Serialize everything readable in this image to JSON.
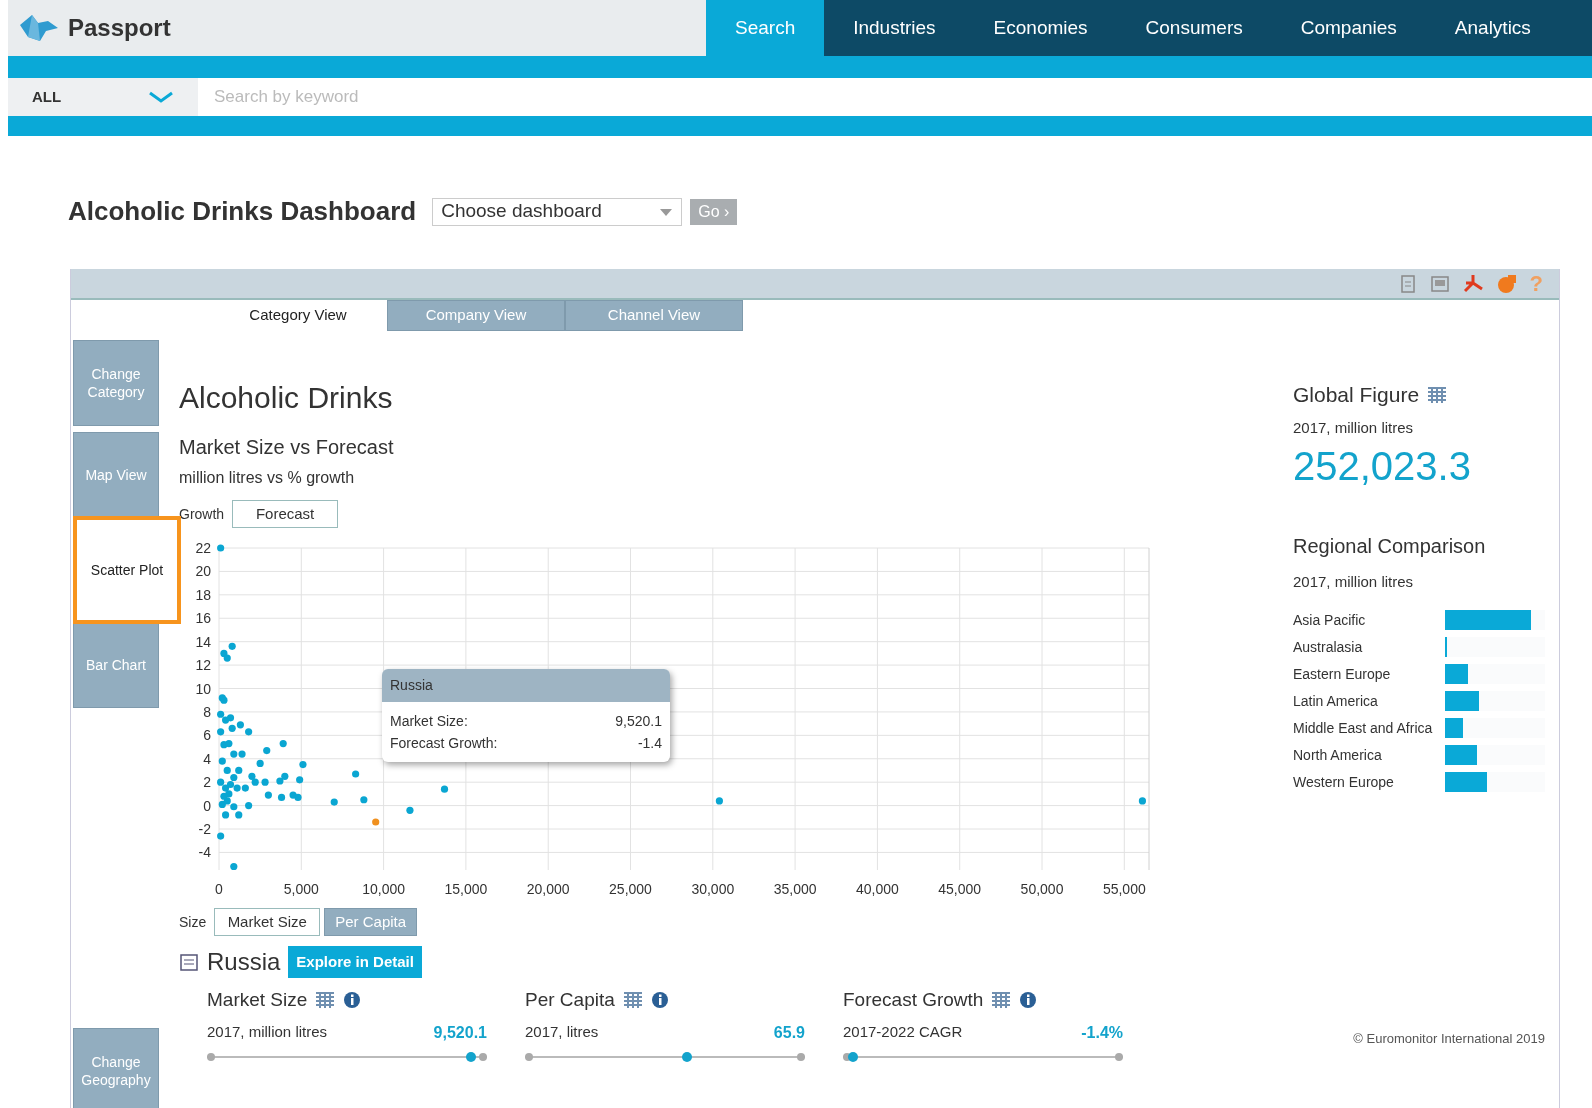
{
  "header": {
    "logo": "Passport",
    "nav": [
      {
        "label": "Search",
        "selected": true
      },
      {
        "label": "Industries",
        "selected": false
      },
      {
        "label": "Economies",
        "selected": false
      },
      {
        "label": "Consumers",
        "selected": false
      },
      {
        "label": "Companies",
        "selected": false
      },
      {
        "label": "Analytics",
        "selected": false
      }
    ]
  },
  "search": {
    "scope": "ALL",
    "placeholder": "Search by keyword"
  },
  "page": {
    "title": "Alcoholic Drinks Dashboard",
    "dashboard_select": "Choose dashboard",
    "go_button": "Go ›"
  },
  "toolbar": {
    "help": "?"
  },
  "tabs": [
    {
      "label": "Category View",
      "selected": true
    },
    {
      "label": "Company View",
      "selected": false
    },
    {
      "label": "Channel View",
      "selected": false
    }
  ],
  "side_buttons": [
    {
      "label": "Change Category",
      "selected": false
    },
    {
      "label": "Map View",
      "selected": false
    },
    {
      "label": "Scatter Plot",
      "selected": true
    },
    {
      "label": "Bar Chart",
      "selected": false
    }
  ],
  "geography_button": "Change Geography",
  "category_title": "Alcoholic Drinks",
  "chart_title": "Market Size vs Forecast",
  "chart_subtitle": "million litres vs % growth",
  "growth": {
    "label": "Growth",
    "options": [
      {
        "label": "Forecast",
        "selected": true
      }
    ]
  },
  "chart_data": {
    "type": "scatter",
    "x": [
      100,
      300,
      500,
      800,
      200,
      300,
      100,
      400,
      700,
      800,
      1300,
      1800,
      100,
      300,
      600,
      900,
      1400,
      2500,
      2900,
      3900,
      200,
      500,
      900,
      1200,
      2000,
      2200,
      2800,
      3700,
      4000,
      4900,
      5100,
      100,
      400,
      700,
      1100,
      1600,
      3000,
      3800,
      4500,
      4800,
      7000,
      8300,
      8800,
      11600,
      13700,
      30400,
      56100,
      200,
      500,
      900,
      1200,
      400,
      100,
      900,
      1800,
      600,
      300,
      9520.1
    ],
    "series": [
      {
        "color": "#0aa6d2",
        "values": [
          22,
          13,
          12.6,
          13.6,
          9.2,
          9,
          7.8,
          7.3,
          7.5,
          6.6,
          6.9,
          6.3,
          6.3,
          5.2,
          5.3,
          4.4,
          4.4,
          3.6,
          4.7,
          5.3,
          3.8,
          3,
          2.4,
          3,
          2.5,
          2,
          2,
          2.1,
          2.5,
          2.2,
          3.5,
          2,
          1.5,
          1.8,
          1.5,
          1.5,
          0.9,
          0.7,
          0.9,
          0.7,
          0.3,
          2.7,
          0.5,
          -0.4,
          1.4,
          0.4,
          0.4,
          0.1,
          0.4,
          -0.1,
          -0.8,
          -0.8,
          -2.6,
          -5.2,
          0,
          1,
          0.8,
          null
        ]
      },
      {
        "color": "#f0901e",
        "values": [
          null,
          null,
          null,
          null,
          null,
          null,
          null,
          null,
          null,
          null,
          null,
          null,
          null,
          null,
          null,
          null,
          null,
          null,
          null,
          null,
          null,
          null,
          null,
          null,
          null,
          null,
          null,
          null,
          null,
          null,
          null,
          null,
          null,
          null,
          null,
          null,
          null,
          null,
          null,
          null,
          null,
          null,
          null,
          null,
          null,
          null,
          null,
          null,
          null,
          null,
          null,
          null,
          null,
          null,
          null,
          null,
          null,
          -1.4
        ]
      }
    ],
    "grid": true,
    "xlim": [
      0,
      56500
    ],
    "ylim": [
      -5.5,
      22
    ],
    "xticks": [
      {
        "value": 0,
        "label": "0"
      },
      {
        "value": 5000,
        "label": "5,000"
      },
      {
        "value": 10000,
        "label": "10,000"
      },
      {
        "value": 15000,
        "label": "15,000"
      },
      {
        "value": 20000,
        "label": "20,000"
      },
      {
        "value": 25000,
        "label": "25,000"
      },
      {
        "value": 30000,
        "label": "30,000"
      },
      {
        "value": 35000,
        "label": "35,000"
      },
      {
        "value": 40000,
        "label": "40,000"
      },
      {
        "value": 45000,
        "label": "45,000"
      },
      {
        "value": 50000,
        "label": "50,000"
      },
      {
        "value": 55000,
        "label": "55,000"
      }
    ],
    "yticks": [
      -4,
      -2,
      0,
      2,
      4,
      6,
      8,
      10,
      12,
      14,
      16,
      18,
      20,
      22
    ]
  },
  "tooltip": {
    "title": "Russia",
    "rows": [
      {
        "label": "Market Size:",
        "value": "9,520.1"
      },
      {
        "label": "Forecast Growth:",
        "value": "-1.4"
      }
    ]
  },
  "size": {
    "label": "Size",
    "options": [
      {
        "label": "Market Size",
        "selected": true
      },
      {
        "label": "Per Capita",
        "selected": false
      }
    ]
  },
  "country": {
    "name": "Russia",
    "explore_button": "Explore in Detail"
  },
  "metrics": [
    {
      "title": "Market Size",
      "subtitle": "2017, million litres",
      "value": "9,520.1",
      "level": 0.96
    },
    {
      "title": "Per Capita",
      "subtitle": "2017, litres",
      "value": "65.9",
      "level": 0.58
    },
    {
      "title": "Forecast Growth",
      "subtitle": "2017-2022 CAGR",
      "value": "-1.4%",
      "level": 0.02
    }
  ],
  "global": {
    "title": "Global Figure",
    "subtitle": "2017, million litres",
    "value": "252,023.3"
  },
  "regional": {
    "title": "Regional Comparison",
    "subtitle": "2017, million litres",
    "regions": [
      {
        "name": "Asia Pacific",
        "level": 0.86
      },
      {
        "name": "Australasia",
        "level": 0.02
      },
      {
        "name": "Eastern Europe",
        "level": 0.23
      },
      {
        "name": "Latin America",
        "level": 0.34
      },
      {
        "name": "Middle East and Africa",
        "level": 0.18
      },
      {
        "name": "North America",
        "level": 0.32
      },
      {
        "name": "Western Europe",
        "level": 0.42
      }
    ]
  },
  "copyright": "© Euromonitor International 2019"
}
